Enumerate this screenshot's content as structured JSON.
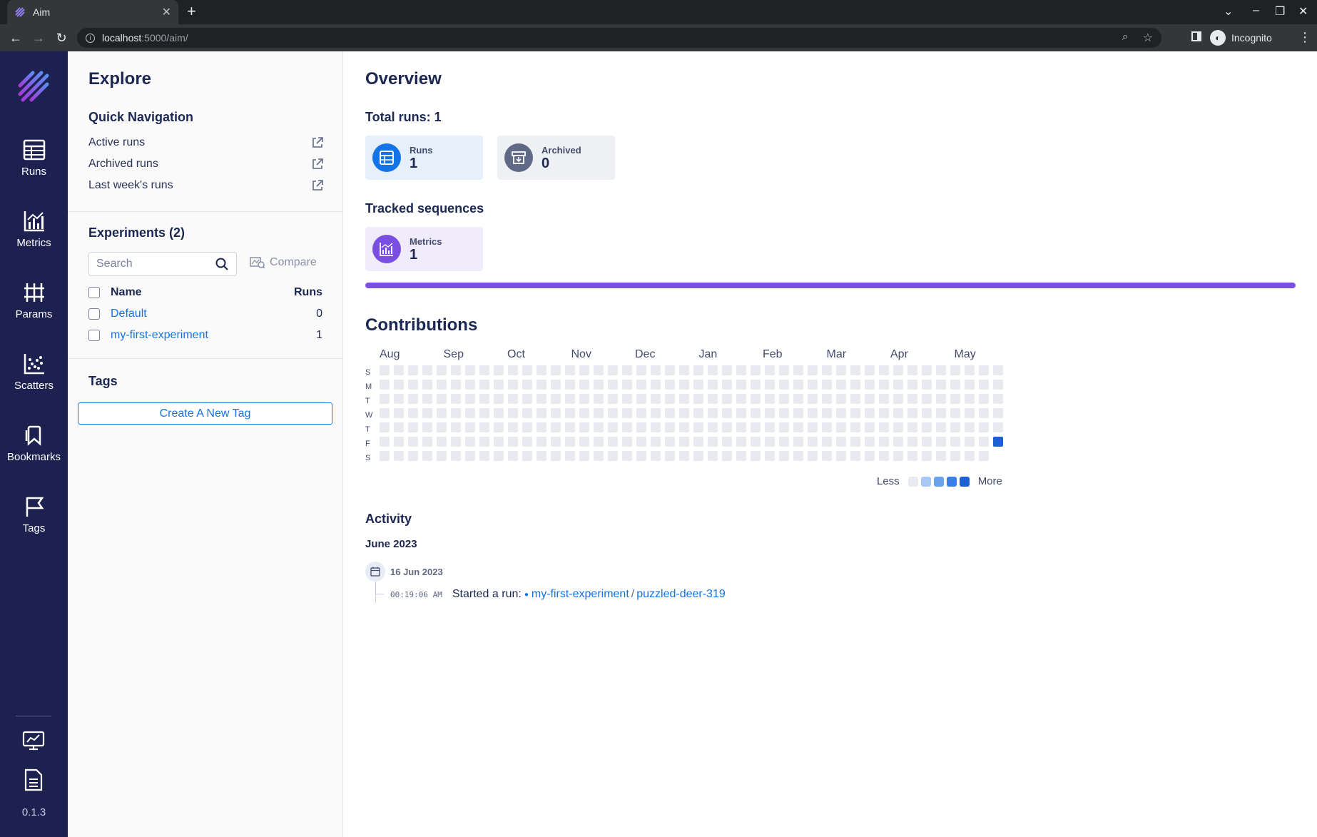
{
  "browser": {
    "tab_title": "Aim",
    "url_host": "localhost",
    "url_path": ":5000/aim/",
    "profile": "Incognito"
  },
  "sidebar": {
    "items": [
      {
        "label": "Runs",
        "icon": "table-icon"
      },
      {
        "label": "Metrics",
        "icon": "bar-chart-icon"
      },
      {
        "label": "Params",
        "icon": "params-icon"
      },
      {
        "label": "Scatters",
        "icon": "scatter-icon"
      },
      {
        "label": "Bookmarks",
        "icon": "bookmark-icon"
      },
      {
        "label": "Tags",
        "icon": "flag-icon"
      }
    ],
    "version": "0.1.3"
  },
  "explore": {
    "title": "Explore",
    "quick_nav_title": "Quick Navigation",
    "quick_nav": [
      "Active runs",
      "Archived runs",
      "Last week's runs"
    ],
    "experiments_title": "Experiments (2)",
    "search_placeholder": "Search",
    "compare_label": "Compare",
    "col_name": "Name",
    "col_runs": "Runs",
    "experiments": [
      {
        "name": "Default",
        "runs": "0"
      },
      {
        "name": "my-first-experiment",
        "runs": "1"
      }
    ],
    "tags_title": "Tags",
    "create_tag_label": "Create A New Tag"
  },
  "overview": {
    "title": "Overview",
    "total_runs": "Total runs: 1",
    "cards": [
      {
        "label": "Runs",
        "value": "1",
        "color": "#1473e6",
        "bg": "#e6f0fb"
      },
      {
        "label": "Archived",
        "value": "0",
        "color": "#606986",
        "bg": "#eef0f3"
      }
    ],
    "tracked_title": "Tracked sequences",
    "tracked_cards": [
      {
        "label": "Metrics",
        "value": "1",
        "color": "#7a4ee0",
        "bg": "#f1ecfb"
      }
    ],
    "progress_fraction": 1.0
  },
  "contributions": {
    "title": "Contributions",
    "months": [
      "Aug",
      "Sep",
      "Oct",
      "Nov",
      "Dec",
      "Jan",
      "Feb",
      "Mar",
      "Apr",
      "May"
    ],
    "day_labels": [
      "S",
      "M",
      "T",
      "W",
      "T",
      "F",
      "S"
    ],
    "weeks": 44,
    "active_cell": {
      "week": 43,
      "day": 5
    },
    "legend_less": "Less",
    "legend_more": "More",
    "legend_colors": [
      "#e8eaf0",
      "#a8c8f5",
      "#6aa2ec",
      "#3a7fe5",
      "#1f5fd4"
    ]
  },
  "activity": {
    "title": "Activity",
    "month": "June 2023",
    "date": "16 Jun 2023",
    "time": "00:19:06 AM",
    "text": "Started a run:",
    "experiment": "my-first-experiment",
    "separator": "/",
    "run": "puzzled-deer-319"
  }
}
